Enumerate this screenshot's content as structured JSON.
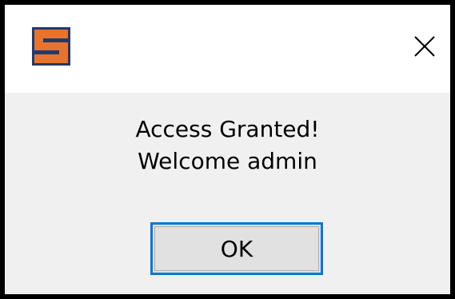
{
  "window": {
    "icon": "orange-s-app-icon",
    "close_icon": "close-x-icon"
  },
  "message": {
    "line1": "Access Granted!",
    "line2": "Welcome admin"
  },
  "buttons": {
    "ok_label": "OK"
  },
  "colors": {
    "icon_orange": "#e8742c",
    "icon_navy": "#213a6b",
    "focus_border": "#0078d7",
    "button_face": "#e1e1e1",
    "dialog_background": "#f0f0f0"
  }
}
